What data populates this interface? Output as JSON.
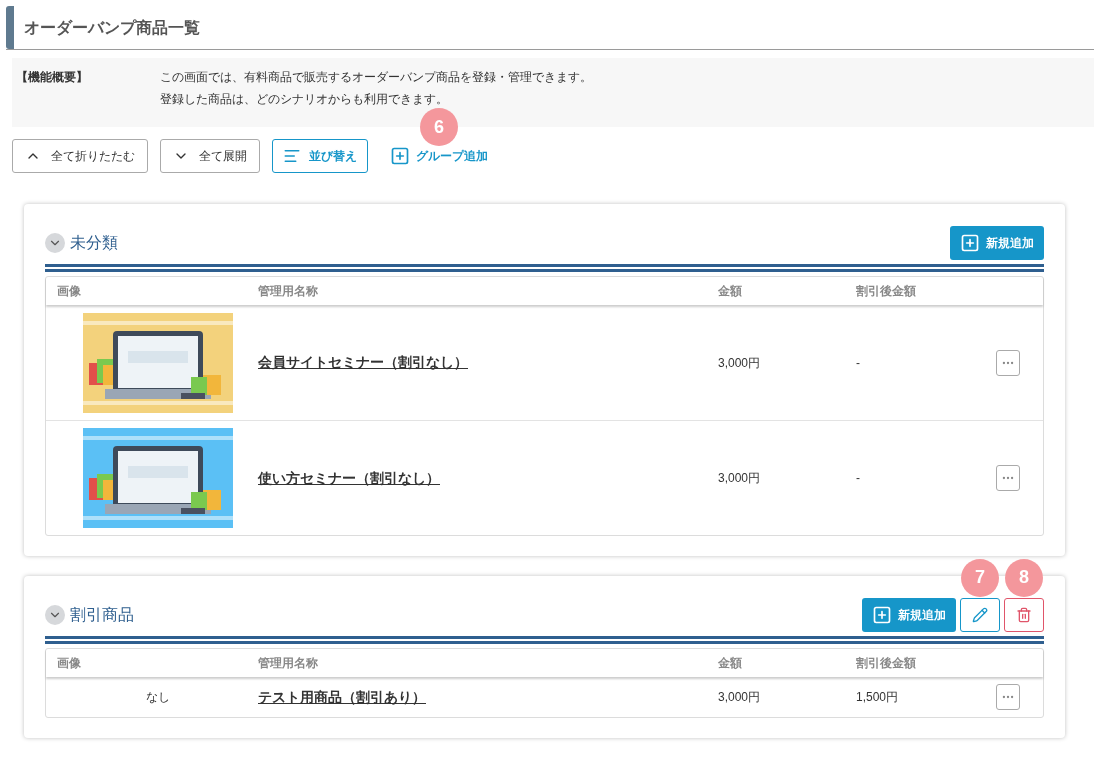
{
  "page_title": "オーダーバンプ商品一覧",
  "overview": {
    "label": "【機能概要】",
    "lines": [
      "この画面では、有料商品で販売するオーダーバンプ商品を登録・管理できます。",
      "登録した商品は、どのシナリオからも利用できます。"
    ]
  },
  "toolbar": {
    "collapse_all": "全て折りたたむ",
    "expand_all": "全て展開",
    "sort": "並び替え",
    "add_group": {
      "label": "グループ追加",
      "callout": "6"
    }
  },
  "groups": [
    {
      "name": "未分類",
      "expanded": true,
      "add_button": "新規追加",
      "columns": [
        "画像",
        "管理用名称",
        "金額",
        "割引後金額"
      ],
      "rows": [
        {
          "name": "会員サイトセミナー（割引なし）",
          "price": "3,000円",
          "discounted": "-"
        },
        {
          "name": "使い方セミナー（割引なし）",
          "price": "3,000円",
          "discounted": "-"
        }
      ]
    },
    {
      "name": "割引商品",
      "expanded": true,
      "add_button": "新規追加",
      "edit_button": {
        "callout": "7"
      },
      "delete_button": {
        "callout": "8"
      },
      "columns": [
        "画像",
        "管理用名称",
        "金額",
        "割引後金額"
      ],
      "rows": [
        {
          "image": {
            "kind": "none",
            "text": "なし"
          },
          "name": "テスト用商品（割引あり）",
          "price": "3,000円",
          "discounted": "1,500円"
        }
      ]
    }
  ]
}
